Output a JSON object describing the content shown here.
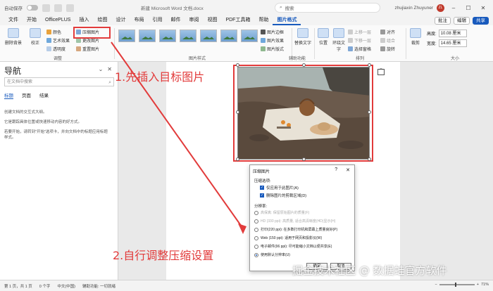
{
  "titlebar": {
    "autosave": "自动保存",
    "doc_title": "新建 Microsoft Word 文档.docx",
    "search_placeholder": "搜索",
    "user": "zhujiaxin Zhuyuner",
    "avatar": "ZL"
  },
  "tabs": [
    "文件",
    "开始",
    "OfficePLUS",
    "插入",
    "绘图",
    "设计",
    "布局",
    "引用",
    "邮件",
    "审阅",
    "视图",
    "PDF工具箱",
    "帮助",
    "图片格式"
  ],
  "active_tab": "图片格式",
  "tabs_right": {
    "comment": "批注",
    "edit": "编辑",
    "share": "共享"
  },
  "ribbon": {
    "remove_bg": "删除背景",
    "corrections": "校正",
    "color": "颜色",
    "artistic": "艺术效果",
    "transparency": "透明度",
    "compress": "压缩图片",
    "change": "更改图片",
    "reset": "重置图片",
    "adjust_group": "调整",
    "styles_group": "图片样式",
    "border": "图片边框",
    "effects": "图片效果",
    "layout": "图片版式",
    "alt_text": "替换文字",
    "accessibility_group": "辅助功能",
    "position": "位置",
    "wrap": "环绕文字",
    "forward": "上移一层",
    "backward": "下移一层",
    "selection_pane": "选择窗格",
    "align": "对齐",
    "group": "组合",
    "rotate": "旋转",
    "arrange_group": "排列",
    "crop": "裁剪",
    "height_label": "高度:",
    "height_value": "10.08 厘米",
    "width_label": "宽度:",
    "width_value": "14.65 厘米",
    "size_group": "大小"
  },
  "nav": {
    "title": "导航",
    "search_placeholder": "在文档中搜索",
    "tabs": [
      "标题",
      "页面",
      "结果"
    ],
    "text1": "创建文档的交互式大纲。",
    "text2": "它是跟踪具体位置或快速移动内容的好方式。",
    "text3": "若要开始，请转到\"开始\"选项卡，并向文档中的标题应用标题样式。"
  },
  "annotations": {
    "step1": "1.先插入目标图片",
    "step2": "2.自行调整压缩设置"
  },
  "dialog": {
    "title": "压缩图片",
    "help": "?",
    "close": "✕",
    "options_label": "压缩选项:",
    "opt1": "仅应用于此图片(A)",
    "opt2": "删除图片的剪裁区域(D)",
    "resolution_label": "分辨率:",
    "res_hifi": "高保真: 保留原始图片的质量(F)",
    "res_hd": "HD (330 ppi): 高质量, 适合高清晰度(HD)显示(H)",
    "res_print": "打印(220 ppi): 在多数打印机和屏幕上质量良好(P)",
    "res_web": "Web (150 ppi): 适用于网页和投影仪(W)",
    "res_email": "电子邮件(96 ppi): 尽可能缩小文档以便共享(E)",
    "res_default": "使用默认分辨率(U)",
    "ok": "确定",
    "cancel": "取消"
  },
  "status": {
    "page": "第 1 页，共 1 页",
    "words": "0 个字",
    "lang": "中文(中国)",
    "accessibility": "辅助功能: 一切就绪",
    "zoom": "71%"
  },
  "watermark": "掘金技术社区 @ 数据蛙官方软件",
  "colors": {
    "accent": "#185abd",
    "annotation": "#e23b3b"
  }
}
